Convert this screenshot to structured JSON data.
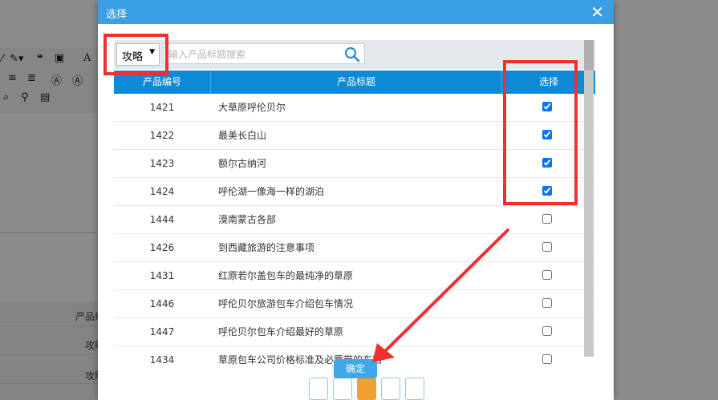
{
  "dialog": {
    "title": "选择",
    "close_label": "✕"
  },
  "filter": {
    "category_selected": "攻略",
    "search_placeholder": "输入产品标题搜索"
  },
  "table": {
    "headers": [
      "产品编号",
      "产品标题",
      "选择"
    ],
    "rows": [
      {
        "id": "1421",
        "title": "大草原呼伦贝尔",
        "checked": true
      },
      {
        "id": "1422",
        "title": "最美长白山",
        "checked": true
      },
      {
        "id": "1423",
        "title": "额尔古纳河",
        "checked": true
      },
      {
        "id": "1424",
        "title": "呼伦湖一像海一样的湖泊",
        "checked": true
      },
      {
        "id": "1444",
        "title": "漠南蒙古各部",
        "checked": false
      },
      {
        "id": "1426",
        "title": "到西藏旅游的注意事项",
        "checked": false
      },
      {
        "id": "1431",
        "title": "红原若尔盖包车的最纯净的草原",
        "checked": false
      },
      {
        "id": "1446",
        "title": "呼伦贝尔旅游包车介绍包车情况",
        "checked": false
      },
      {
        "id": "1447",
        "title": "呼伦贝尔包车介绍最好的草原",
        "checked": false
      },
      {
        "id": "1434",
        "title": "草原包车公司价格标准及必需带的东西",
        "checked": false
      }
    ]
  },
  "footer": {
    "confirm_label": "确定"
  },
  "background": {
    "label_product": "产品编",
    "label_row1": "攻略",
    "label_row2": "攻略"
  },
  "colors": {
    "header_blue": "#3a9ee4",
    "table_head_blue": "#0d8ad6",
    "annotation_red": "#f03030",
    "active_page": "#f0a030"
  }
}
